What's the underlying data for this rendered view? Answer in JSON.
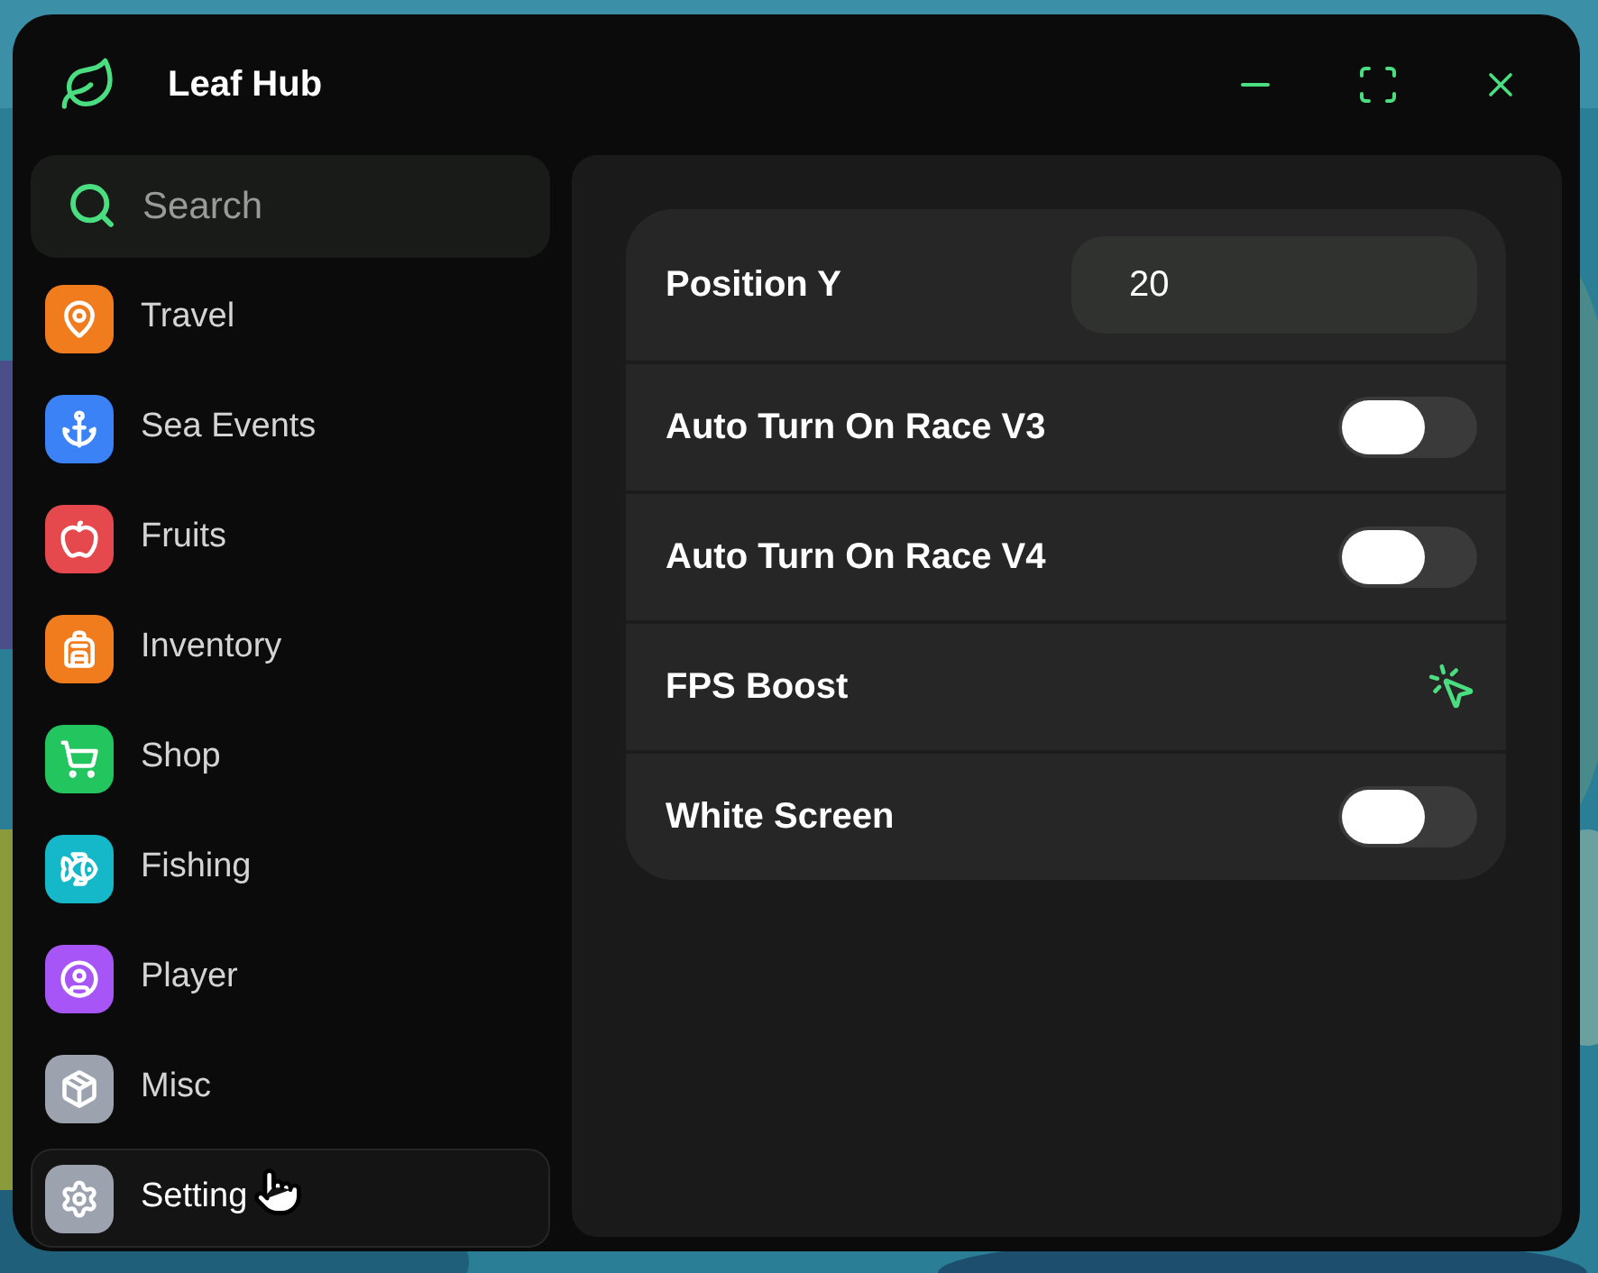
{
  "window": {
    "title": "Leaf Hub"
  },
  "search": {
    "placeholder": "Search"
  },
  "sidebar": {
    "items": [
      {
        "label": "Travel",
        "color": "#f07c1e",
        "selected": false
      },
      {
        "label": "Sea Events",
        "color": "#3b82f6",
        "selected": false
      },
      {
        "label": "Fruits",
        "color": "#e5484d",
        "selected": false
      },
      {
        "label": "Inventory",
        "color": "#f07c1e",
        "selected": false
      },
      {
        "label": "Shop",
        "color": "#22c55e",
        "selected": false
      },
      {
        "label": "Fishing",
        "color": "#14b8c8",
        "selected": false
      },
      {
        "label": "Player",
        "color": "#a855f7",
        "selected": false
      },
      {
        "label": "Misc",
        "color": "#9ca3af",
        "selected": false
      },
      {
        "label": "Setting",
        "color": "#9ca3af",
        "selected": true
      }
    ]
  },
  "settings": [
    {
      "kind": "input",
      "label": "Position Y",
      "value": "20"
    },
    {
      "kind": "toggle",
      "label": "Auto Turn On Race V3",
      "on": false
    },
    {
      "kind": "toggle",
      "label": "Auto Turn On Race V4",
      "on": false
    },
    {
      "kind": "button",
      "label": "FPS Boost"
    },
    {
      "kind": "toggle",
      "label": "White Screen",
      "on": false
    }
  ]
}
